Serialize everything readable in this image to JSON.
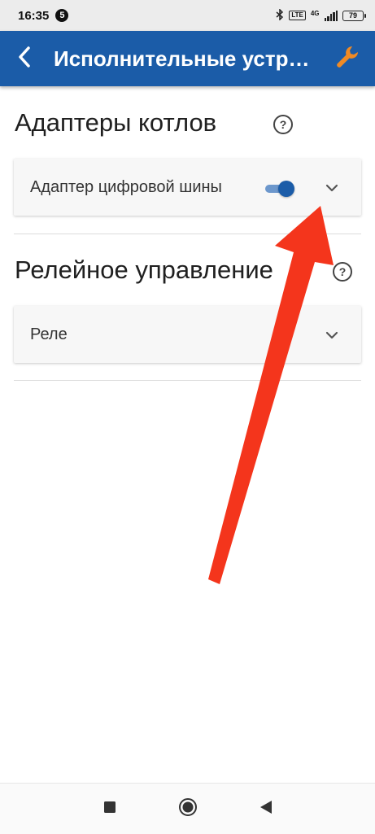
{
  "status_bar": {
    "time": "16:35",
    "notification_badge": "5",
    "network": "4G",
    "volte": "LTE",
    "battery": "79"
  },
  "app_bar": {
    "title": "Исполнительные устройства",
    "back_icon": "chevron-left-icon",
    "action_icon": "wrench-icon",
    "accent_color": "#1b5ca8",
    "action_color": "#f08a24"
  },
  "sections": [
    {
      "title": "Адаптеры котлов",
      "items": [
        {
          "label": "Адаптер цифровой шины",
          "toggle_on": true
        }
      ]
    },
    {
      "title": "Релейное управление",
      "items": [
        {
          "label": "Реле"
        }
      ]
    }
  ],
  "annotation": {
    "color": "#f4351c",
    "shape": "arrow"
  },
  "nav_bar": {
    "buttons": [
      "recents-square-icon",
      "home-circle-icon",
      "back-triangle-icon"
    ]
  }
}
